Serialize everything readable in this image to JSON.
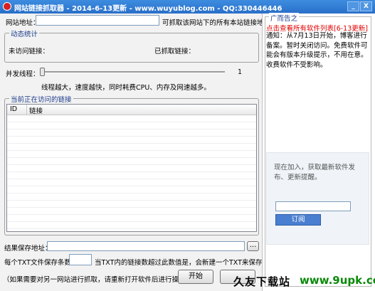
{
  "window": {
    "title": "网站链接抓取器 - 2014-6-13更新 - www.wuyublog.com - QQ:330446446",
    "minimize": "_",
    "close": "X"
  },
  "site": {
    "label": "网站地址：",
    "value": "",
    "hint": "可抓取该网站下的所有本站链接地址。"
  },
  "stats": {
    "legend": "动态统计",
    "unvisited_label": "未访问链接：",
    "fetched_label": "已抓取链接："
  },
  "threads": {
    "label": "并发线程：",
    "value": "1",
    "note": "线程越大，速度越快，同时耗费CPU、内存及网速越多。"
  },
  "links": {
    "legend": "当前正在访问的链接",
    "columns": [
      "ID",
      "链接"
    ],
    "rows": []
  },
  "save": {
    "label": "结果保存地址：",
    "browse_label": "...",
    "per_file_label": "每个TXT文件保存条数：",
    "per_file_note": "当TXT内的链接数超过此数值是，会新建一个TXT来保存新链接"
  },
  "footer": {
    "note": "（如果需要对另一网站进行抓取，请重新打开软件后进行操作！）",
    "start_label": "开始"
  },
  "ad": {
    "legend": "广而告之",
    "link_text": "点击查看所有软件列表[6-13更新]",
    "notice": "通知：从7月13日开始，博客进行备案。暂时关闭访问。免费软件可能会有版本升级提示，不用在意。收费软件不受影响。",
    "subscribe_text": "现在加入，获取最新软件发布、更新提醒。",
    "subscribe_button": "订阅"
  },
  "watermark": {
    "brand": "久友下载站",
    "url": "www.9upk.com"
  }
}
